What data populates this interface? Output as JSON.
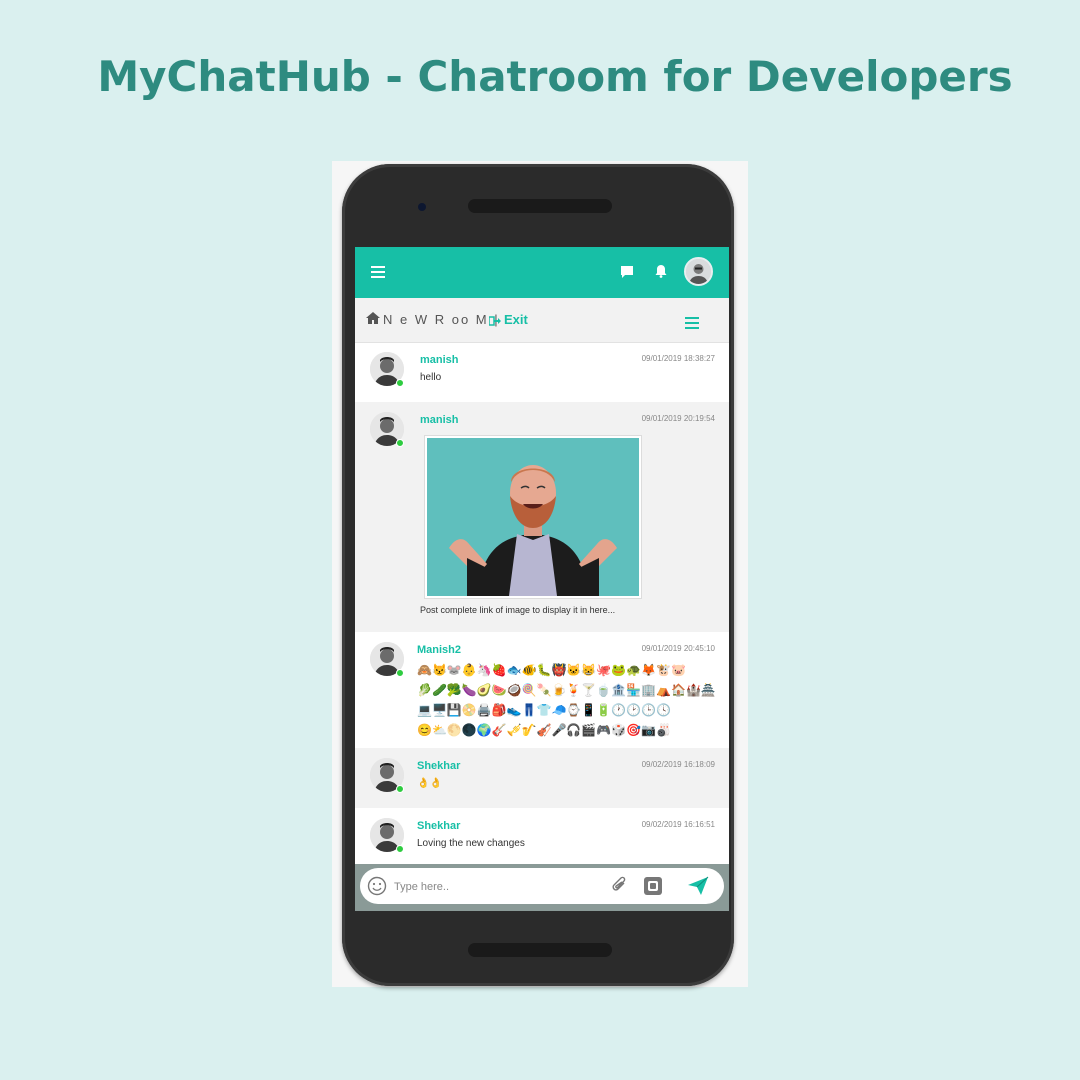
{
  "page": {
    "title": "MyChatHub - Chatroom for Developers"
  },
  "colors": {
    "background": "#daf0ef",
    "accent": "#17bfa6",
    "title": "#2e8b80"
  },
  "appbar": {
    "icons": [
      "menu-icon",
      "chat-icon",
      "bell-icon",
      "avatar"
    ]
  },
  "room": {
    "name": "N e W R oo M |",
    "exit_label": "Exit"
  },
  "messages": [
    {
      "user": "manish",
      "time": "09/01/2019 18:38:27",
      "text": "hello"
    },
    {
      "user": "manish",
      "time": "09/01/2019 20:19:54",
      "image_caption": "Post complete link of image to display it in here..."
    },
    {
      "user": "Manish2",
      "time": "09/01/2019 20:45:10",
      "emoji_lines": [
        "🙈😾🐭👶🦄🍓🐟🐠🐛👹🐱😸🐙🐸🐢🦊🐮🐷",
        "🥬🥒🥦🍆🥑🍉🥥🍭🍡🍺🍹🍸🍵🏦🏪🏢⛺🏠🏰🏯",
        "💻🖥️💾📀🖨️🎒👟👖👕🧢⌚📱🔋🕐🕑🕒🕓",
        "😊⛅🌕🌑🌍🎸🎺🎷🎻🎤🎧🎬🎮🎲🎯📷🎳"
      ]
    },
    {
      "user": "Shekhar",
      "time": "09/02/2019 16:18:09",
      "text": "👌👌"
    },
    {
      "user": "Shekhar",
      "time": "09/02/2019 16:16:51",
      "text": "Loving the new changes"
    }
  ],
  "composer": {
    "placeholder": "Type here.."
  }
}
